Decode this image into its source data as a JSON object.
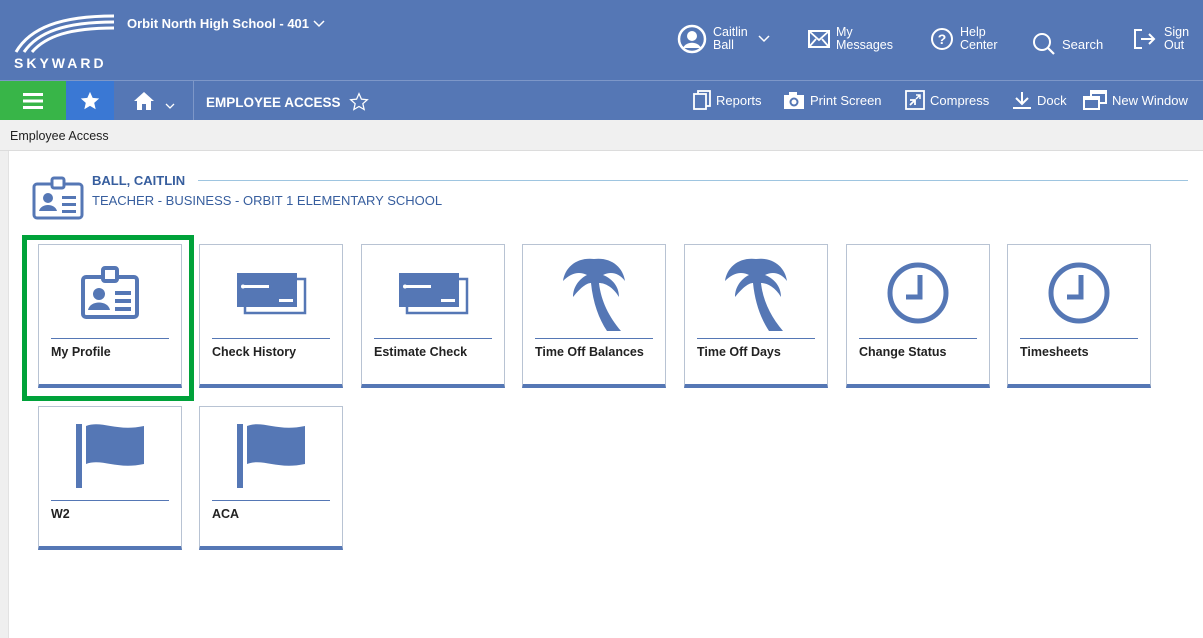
{
  "header": {
    "logo_text": "SKYWARD",
    "school": "Orbit North High School - 401",
    "user_first": "Caitlin",
    "user_last": "Ball",
    "messages_1": "My",
    "messages_2": "Messages",
    "help_1": "Help",
    "help_2": "Center",
    "search": "Search",
    "signout_1": "Sign",
    "signout_2": "Out"
  },
  "toolbar": {
    "page_title": "EMPLOYEE ACCESS",
    "reports": "Reports",
    "print_screen": "Print Screen",
    "compress": "Compress",
    "dock": "Dock",
    "new_window": "New Window"
  },
  "breadcrumb": "Employee Access",
  "employee": {
    "name": "BALL, CAITLIN",
    "role": "TEACHER - BUSINESS - ORBIT 1 ELEMENTARY SCHOOL"
  },
  "tiles": [
    {
      "label": "My Profile",
      "icon": "profile-card-icon"
    },
    {
      "label": "Check History",
      "icon": "check-icon"
    },
    {
      "label": "Estimate Check",
      "icon": "check-icon"
    },
    {
      "label": "Time Off Balances",
      "icon": "palm-tree-icon"
    },
    {
      "label": "Time Off Days",
      "icon": "palm-tree-icon"
    },
    {
      "label": "Change Status",
      "icon": "clock-icon"
    },
    {
      "label": "Timesheets",
      "icon": "clock-icon"
    },
    {
      "label": "W2",
      "icon": "flag-icon"
    },
    {
      "label": "ACA",
      "icon": "flag-icon"
    }
  ],
  "colors": {
    "brand_blue": "#5577b5",
    "menu_green": "#38b548",
    "star_blue": "#3a78d4",
    "highlight_green": "#00a23a",
    "text_blue": "#375e9e"
  }
}
